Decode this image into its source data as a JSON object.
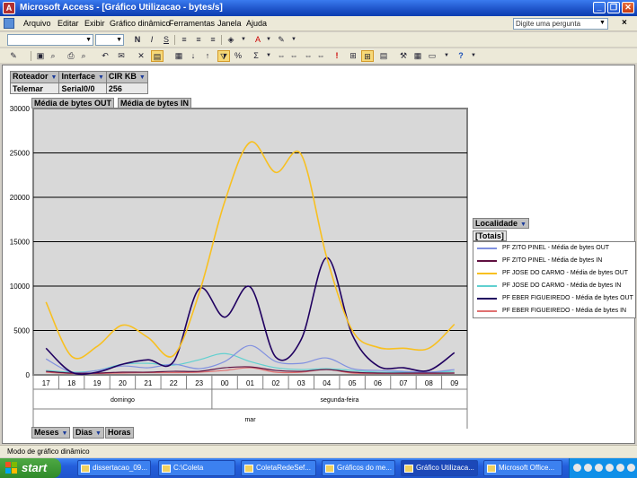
{
  "window": {
    "title": "Microsoft Access - [Gráfico Utilizacao  - bytes/s]",
    "app_icon": "access-icon"
  },
  "menu": {
    "items": [
      "Arquivo",
      "Editar",
      "Exibir",
      "Gráfico dinâmico",
      "Ferramentas",
      "Janela",
      "Ajuda"
    ],
    "help_placeholder": "Digite uma pergunta"
  },
  "filter_fields": [
    {
      "label": "Roteador",
      "value": "Telemar"
    },
    {
      "label": "Interface",
      "value": "Serial0/0"
    },
    {
      "label": "CIR KB",
      "value": "256"
    }
  ],
  "data_fields": [
    "Média de bytes OUT",
    "Média de bytes IN"
  ],
  "legend": {
    "title": "Localidade",
    "field": "[Totais]",
    "items": [
      {
        "label": "PF ZITO PINEL - Média de bytes OUT",
        "color": "#8090e0"
      },
      {
        "label": "PF ZITO PINEL - Média de bytes IN",
        "color": "#601040"
      },
      {
        "label": "PF JOSE DO CARMO - Média de bytes OUT",
        "color": "#f8c020"
      },
      {
        "label": "PF JOSE DO CARMO - Média de bytes IN",
        "color": "#60d0d0"
      },
      {
        "label": "PF EBER FIGUEIREDO - Média de bytes OUT",
        "color": "#200060"
      },
      {
        "label": "PF EBER FIGUEIREDO - Média de bytes IN",
        "color": "#e07070"
      }
    ]
  },
  "bottom_fields": [
    "Meses",
    "Dias",
    "Horas"
  ],
  "status": "Modo de gráfico dinâmico",
  "taskbar": {
    "start": "start",
    "tasks": [
      "dissertacao_09...",
      "C:\\Coleta",
      "ColetaRedeSef...",
      "Gráficos do me...",
      "Gráfico Utilizaca...",
      "Microsoft Office..."
    ],
    "active_index": 4
  },
  "chart_data": {
    "type": "line",
    "categories": [
      "17",
      "18",
      "19",
      "20",
      "21",
      "22",
      "23",
      "00",
      "01",
      "02",
      "03",
      "04",
      "05",
      "06",
      "07",
      "08",
      "09"
    ],
    "x_groups_level1": [
      {
        "label": "domingo",
        "from": 0,
        "to": 6
      },
      {
        "label": "segunda-feira",
        "from": 7,
        "to": 16
      }
    ],
    "x_groups_level2": [
      {
        "label": "mar",
        "from": 0,
        "to": 16
      }
    ],
    "ylim": [
      0,
      30000
    ],
    "yticks": [
      0,
      5000,
      10000,
      15000,
      20000,
      25000,
      30000
    ],
    "grid": true,
    "legend_position": "right",
    "series": [
      {
        "name": "PF ZITO PINEL - Média de bytes OUT",
        "color": "#8090e0",
        "values": [
          1800,
          300,
          500,
          1000,
          800,
          1200,
          700,
          1500,
          3300,
          1500,
          1300,
          1900,
          700,
          500,
          400,
          300,
          600
        ]
      },
      {
        "name": "PF ZITO PINEL - Média de bytes IN",
        "color": "#601040",
        "values": [
          400,
          200,
          200,
          300,
          300,
          400,
          400,
          800,
          900,
          500,
          400,
          600,
          300,
          200,
          200,
          200,
          200
        ]
      },
      {
        "name": "PF JOSE DO CARMO - Média de bytes OUT",
        "color": "#f8c020",
        "values": [
          8200,
          2100,
          3200,
          5600,
          4200,
          2200,
          9200,
          19500,
          26200,
          22800,
          24800,
          13200,
          5000,
          3100,
          3000,
          3000,
          5700
        ]
      },
      {
        "name": "PF JOSE DO CARMO - Média de bytes IN",
        "color": "#60d0d0",
        "values": [
          500,
          300,
          500,
          1200,
          1300,
          1100,
          1700,
          2400,
          1500,
          800,
          600,
          700,
          500,
          300,
          300,
          300,
          400
        ]
      },
      {
        "name": "PF EBER FIGUEIREDO - Média de bytes OUT",
        "color": "#200060",
        "values": [
          3000,
          300,
          300,
          1200,
          1700,
          1500,
          9700,
          6500,
          9900,
          2000,
          4000,
          13200,
          4500,
          1000,
          800,
          500,
          2500
        ]
      },
      {
        "name": "PF EBER FIGUEIREDO - Média de bytes IN",
        "color": "#e07070",
        "values": [
          300,
          150,
          150,
          200,
          250,
          250,
          300,
          500,
          800,
          300,
          300,
          600,
          200,
          150,
          150,
          150,
          200
        ]
      }
    ]
  }
}
